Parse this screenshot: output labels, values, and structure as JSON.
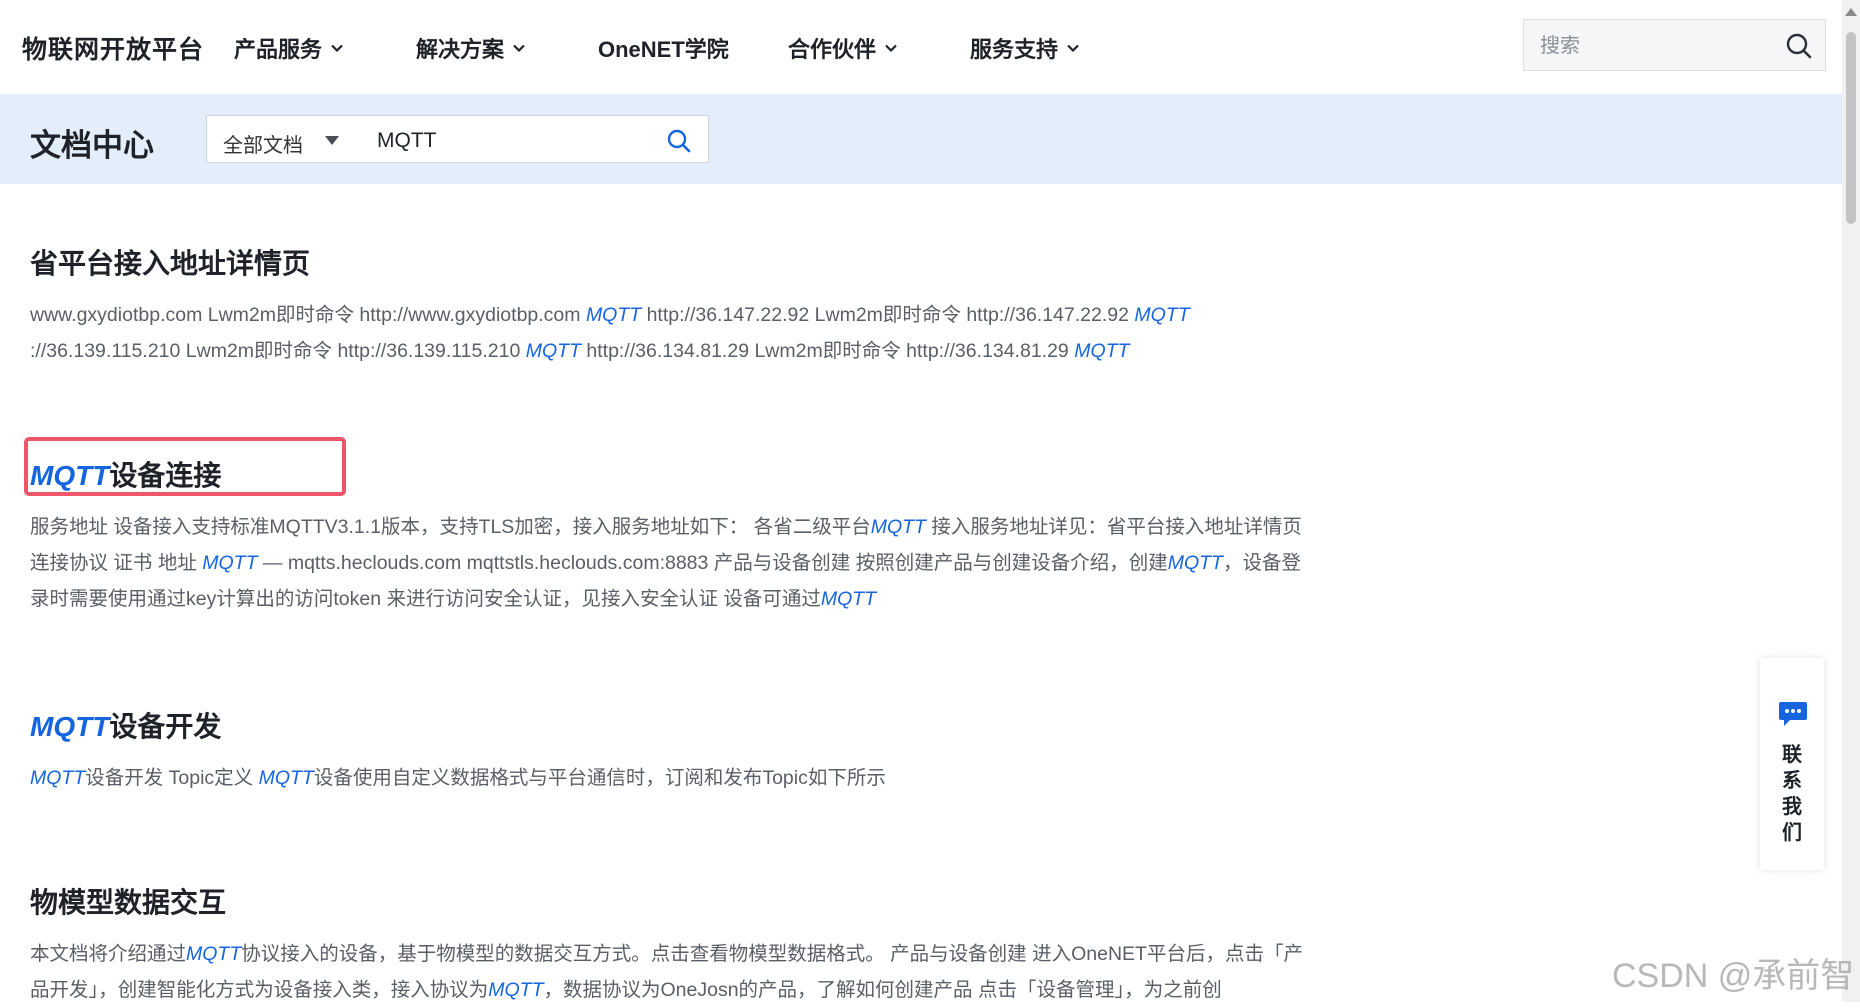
{
  "nav": {
    "brand": "物联网开放平台",
    "items": [
      {
        "label": "产品服务",
        "dropdown": true
      },
      {
        "label": "解决方案",
        "dropdown": true
      },
      {
        "label": "OneNET学院",
        "dropdown": false
      },
      {
        "label": "合作伙伴",
        "dropdown": true
      },
      {
        "label": "服务支持",
        "dropdown": true
      }
    ],
    "search_placeholder": "搜索",
    "search_icon": "search-icon"
  },
  "docbar": {
    "title": "文档中心",
    "scope_selected": "全部文档",
    "query": "MQTT"
  },
  "results": [
    {
      "title": [
        {
          "t": "省平台接入地址详情页",
          "hl": false
        }
      ],
      "snippet": [
        {
          "t": "www.gxydiotbp.com Lwm2m即时命令 http://www.gxydiotbp.com ",
          "hl": false
        },
        {
          "t": "MQTT",
          "hl": true
        },
        {
          "t": " http://36.147.22.92 Lwm2m即时命令 http://36.147.22.92 ",
          "hl": false
        },
        {
          "t": "MQTT",
          "hl": true
        },
        {
          "t": " ://36.139.115.210 Lwm2m即时命令 http://36.139.115.210 ",
          "hl": false
        },
        {
          "t": "MQTT",
          "hl": true
        },
        {
          "t": " http://36.134.81.29 Lwm2m即时命令 http://36.134.81.29 ",
          "hl": false
        },
        {
          "t": "MQTT",
          "hl": true
        }
      ]
    },
    {
      "title": [
        {
          "t": "MQTT",
          "hl": true
        },
        {
          "t": "设备连接",
          "hl": false
        }
      ],
      "snippet": [
        {
          "t": "服务地址 设备接入支持标准MQTTV3.1.1版本，支持TLS加密，接入服务地址如下： 各省二级平台",
          "hl": false
        },
        {
          "t": "MQTT",
          "hl": true
        },
        {
          "t": " 接入服务地址详见：省平台接入地址详情页 连接协议 证书 地址 ",
          "hl": false
        },
        {
          "t": "MQTT",
          "hl": true
        },
        {
          "t": " — mqtts.heclouds.com mqttstls.heclouds.com:8883 产品与设备创建 按照创建产品与创建设备介绍，创建",
          "hl": false
        },
        {
          "t": "MQTT",
          "hl": true
        },
        {
          "t": "，设备登录时需要使用通过key计算出的访问token 来进行访问安全认证，见接入安全认证 设备可通过",
          "hl": false
        },
        {
          "t": "MQTT",
          "hl": true
        }
      ]
    },
    {
      "title": [
        {
          "t": "MQTT",
          "hl": true
        },
        {
          "t": "设备开发",
          "hl": false
        }
      ],
      "snippet": [
        {
          "t": "MQTT",
          "hl": true
        },
        {
          "t": "设备开发 Topic定义 ",
          "hl": false
        },
        {
          "t": "MQTT",
          "hl": true
        },
        {
          "t": "设备使用自定义数据格式与平台通信时，订阅和发布Topic如下所示",
          "hl": false
        }
      ]
    },
    {
      "title": [
        {
          "t": "物模型数据交互",
          "hl": false
        }
      ],
      "snippet": [
        {
          "t": "本文档将介绍通过",
          "hl": false
        },
        {
          "t": "MQTT",
          "hl": true
        },
        {
          "t": "协议接入的设备，基于物模型的数据交互方式。点击查看物模型数据格式。 产品与设备创建 进入OneNET平台后，点击「产品开发」，创建智能化方式为设备接入类，接入协议为",
          "hl": false
        },
        {
          "t": "MQTT",
          "hl": true
        },
        {
          "t": "，数据协议为OneJosn的产品，了解如何创建产品 点击「设备管理」，为之前创",
          "hl": false
        }
      ]
    }
  ],
  "contact": {
    "chars": [
      "联",
      "系",
      "我",
      "们"
    ],
    "icon": "chat-icon"
  },
  "watermark": "CSDN @承前智",
  "colors": {
    "highlight": "#1665e0",
    "docbar_bg": "#e4eefb",
    "annotation_box": "#f0566a"
  }
}
